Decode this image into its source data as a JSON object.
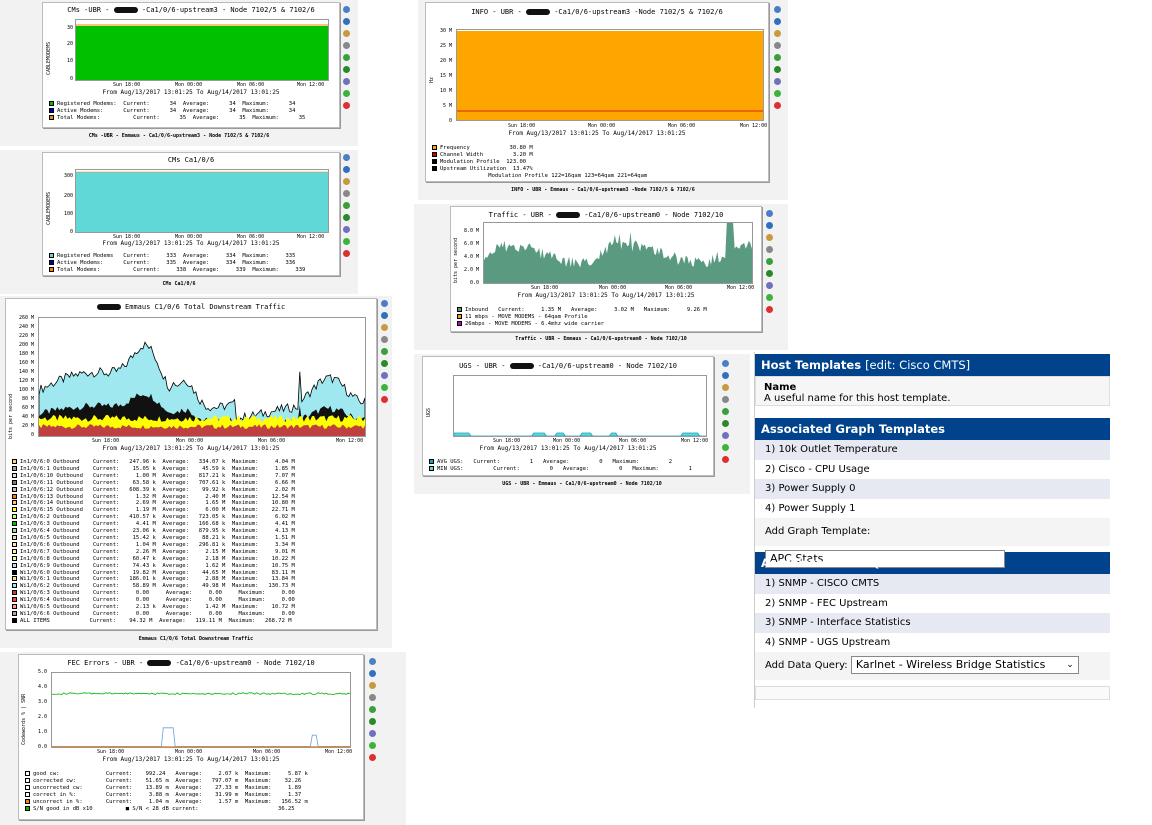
{
  "redacted": "",
  "tool_icons": [
    {
      "icon": "zoom-icon",
      "color": "#4a7fc8"
    },
    {
      "icon": "query-icon",
      "color": "#3070c0"
    },
    {
      "icon": "wrench-icon",
      "color": "#c89a40"
    },
    {
      "icon": "spike-icon",
      "color": "#888888"
    },
    {
      "icon": "csv-icon",
      "color": "#3aa03a"
    },
    {
      "icon": "bars-icon",
      "color": "#2a8a2a"
    },
    {
      "icon": "properties-icon",
      "color": "#7070c0"
    },
    {
      "icon": "add-icon",
      "color": "#3cb43c"
    },
    {
      "icon": "delete-icon",
      "color": "#dd3030"
    }
  ],
  "graphs": {
    "cms_upstream3": {
      "title_a": "CMs -UBR -",
      "title_b": "-Ca1/0/6-upstream3 - Node 7102/5 & 7102/6",
      "ylabel": "CABLEMODEMS",
      "yticks": [
        "30",
        "20",
        "10",
        "0"
      ],
      "xticks": [
        "Sun 18:00",
        "Mon 00:00",
        "Mon 06:00",
        "Mon 12:00"
      ],
      "range": "From Aug/13/2017 13:01:25 To Aug/14/2017 13:01:25",
      "legend": [
        {
          "color": "#00c000",
          "text": "Registered Modems:  Current:      34  Average:      34  Maximum:      34"
        },
        {
          "color": "#0000a0",
          "text": "Active Modems:      Current:      34  Average:      34  Maximum:      34"
        },
        {
          "color": "#ff8000",
          "text": "Total Modems:          Current:      35  Average:      35  Maximum:      35"
        }
      ],
      "caption": "CMs -UBR - Emmaus - Ca1/0/6-upstream3 - Node 7102/5 & 7102/6"
    },
    "cms_ca": {
      "title": "CMs Ca1/0/6",
      "ylabel": "CABLEMODEMS",
      "yticks": [
        "300",
        "200",
        "100",
        "0"
      ],
      "xticks": [
        "Sun 18:00",
        "Mon 00:00",
        "Mon 06:00",
        "Mon 12:00"
      ],
      "range": "From Aug/13/2017 13:01:25 To Aug/14/2017 13:01:25",
      "legend": [
        {
          "color": "#60d8d8",
          "text": "Registered Modems   Current:     333  Average:     334  Maximum:     335"
        },
        {
          "color": "#0000a0",
          "text": "Active Modems:      Current:     335  Average:     334  Maximum:     336"
        },
        {
          "color": "#ff8000",
          "text": "Total Modems:          Current:     338  Average:     339  Maximum:     339"
        }
      ],
      "caption": "CMs Ca1/0/6"
    },
    "downstream": {
      "title": "Emmaus C1/0/6 Total Downstream Traffic",
      "ylabel": "bits per second",
      "yticks": [
        "260 M",
        "240 M",
        "220 M",
        "200 M",
        "180 M",
        "160 M",
        "140 M",
        "120 M",
        "100 M",
        "80 M",
        "60 M",
        "40 M",
        "20 M",
        "0"
      ],
      "xticks": [
        "Sun 18:00",
        "Mon 00:00",
        "Mon 06:00",
        "Mon 12:00"
      ],
      "range": "From Aug/13/2017 13:01:25 To Aug/14/2017 13:01:25",
      "legend": [
        {
          "color": "#f4d880",
          "text": "In1/0/6:0 Outbound    Current:   247.96 k  Average:   334.07 k  Maximum:     4.04 M"
        },
        {
          "color": "#a0a0a0",
          "text": "In1/0/6:1 Outbound    Current:    15.05 k  Average:    45.59 k  Maximum:     1.85 M"
        },
        {
          "color": "#e0e0e0",
          "text": "In1/0/6:10 Outbound   Current:     1.00 M  Average:   817.21 k  Maximum:     7.07 M"
        },
        {
          "color": "#808080",
          "text": "In1/0/6:11 Outbound   Current:    63.58 k  Average:   707.61 k  Maximum:     6.66 M"
        },
        {
          "color": "#c0c0c0",
          "text": "In1/0/6:12 Outbound   Current:   608.39 k  Average:    99.92 k  Maximum:     2.02 M"
        },
        {
          "color": "#ff8000",
          "text": "In1/0/6:13 Outbound   Current:     1.32 M  Average:     2.40 M  Maximum:    12.54 M"
        },
        {
          "color": "#ffc080",
          "text": "In1/0/6:14 Outbound   Current:     2.69 M  Average:     1.65 M  Maximum:    10.80 M"
        },
        {
          "color": "#ffff00",
          "text": "In1/0/6:15 Outbound   Current:     1.19 M  Average:     6.00 M  Maximum:    22.71 M"
        },
        {
          "color": "#c0ff80",
          "text": "In1/0/6:2 Outbound    Current:   410.57 k  Average:   723.05 k  Maximum:     6.02 M"
        },
        {
          "color": "#00c000",
          "text": "In1/0/6:3 Outbound    Current:     4.41 M  Average:   166.68 k  Maximum:     4.41 M"
        },
        {
          "color": "#a0e0a0",
          "text": "In1/0/6:4 Outbound    Current:    23.06 k  Average:   879.95 k  Maximum:     4.13 M"
        },
        {
          "color": "#e0e0a0",
          "text": "In1/0/6:5 Outbound    Current:    15.42 k  Average:    88.21 k  Maximum:     1.51 M"
        },
        {
          "color": "#ffe0c0",
          "text": "In1/0/6:6 Outbound    Current:     1.04 M  Average:   296.81 k  Maximum:     3.34 M"
        },
        {
          "color": "#fff0a0",
          "text": "In1/0/6:7 Outbound    Current:     2.26 M  Average:     2.15 M  Maximum:     9.01 M"
        },
        {
          "color": "#e0ffa0",
          "text": "In1/0/6:8 Outbound    Current:    60.47 k  Average:     2.18 M  Maximum:    10.22 M"
        },
        {
          "color": "#c0e0ff",
          "text": "In1/0/6:9 Outbound    Current:    74.43 k  Average:     1.62 M  Maximum:    10.75 M"
        },
        {
          "color": "#000000",
          "text": "Wi1/0/6:0 Outbound    Current:    19.82 M  Average:    44.65 M  Maximum:    83.11 M"
        },
        {
          "color": "#ffe080",
          "text": "Wi1/0/6:1 Outbound    Current:   186.01 k  Average:     2.88 M  Maximum:    13.84 M"
        },
        {
          "color": "#a0e8f0",
          "text": "Wi1/0/6:2 Outbound    Current:    58.89 M  Average:    49.98 M  Maximum:   130.73 M"
        },
        {
          "color": "#c04040",
          "text": "Wi1/0/6:3 Outbound    Current:     0.00     Average:     0.00     Maximum:     0.00"
        },
        {
          "color": "#ff4040",
          "text": "Wi1/0/6:4 Outbound    Current:     0.00     Average:     0.00     Maximum:     0.00"
        },
        {
          "color": "#ffa0a0",
          "text": "Wi1/0/6:5 Outbound    Current:     2.13 k  Average:     1.42 M  Maximum:    10.72 M"
        },
        {
          "color": "#c0a0a0",
          "text": "Wi1/0/6:6 Outbound    Current:     0.00     Average:     0.00     Maximum:     0.00"
        },
        {
          "color": "#000000",
          "text": "ALL ITEMS            Current:    94.32 M  Average:   119.11 M  Maximum:   268.72 M"
        }
      ],
      "caption": "Emmaus C1/0/6 Total Downstream Traffic"
    },
    "fec": {
      "title_a": "FEC Errors  - UBR  -",
      "title_b": "-Ca1/0/6-upstream0 - Node 7102/10",
      "ylabel": "Codewords % | SNR",
      "yticks": [
        "5.0",
        "4.0",
        "3.0",
        "2.0",
        "1.0",
        "0.0"
      ],
      "xticks": [
        "Sun 18:00",
        "Mon 00:00",
        "Mon 06:00",
        "Mon 12:00"
      ],
      "range": "From Aug/13/2017 13:01:25 To Aug/14/2017 13:01:25",
      "legend": [
        {
          "color": "#ffffff",
          "text": "good cw:              Current:    992.24   Average:     2.07 k  Maximum:     5.87 k"
        },
        {
          "color": "#ffffff",
          "text": "corrected cw:         Current:    51.65 m  Average:   797.07 m  Maximum:    32.26"
        },
        {
          "color": "#ffffff",
          "text": "uncorrected cw:       Current:    13.89 m  Average:    27.33 m  Maximum:     1.89"
        },
        {
          "color": "#ffffff",
          "text": "correct in %:         Current:     3.88 m  Average:    31.99 m  Maximum:     1.37"
        },
        {
          "color": "#ff8000",
          "text": "uncorrect in %:       Current:     1.04 m  Average:     1.57 m  Maximum:   156.52 m"
        },
        {
          "color": "#00c000",
          "text": "S/N good in dB x10          ■ S/N < 28 dB current:                        36.25"
        }
      ],
      "caption": "FEC Errors - UBR - Emmaus - Ca1/0/6-upstream0 - Node 7102/10"
    },
    "info": {
      "title_a": "INFO - UBR  -",
      "title_b": "-Ca1/0/6-upstream3 -Node 7102/5 & 7102/6",
      "ylabel": "Hz",
      "yticks": [
        "30 M",
        "25 M",
        "20 M",
        "15 M",
        "10 M",
        "5 M",
        "0"
      ],
      "xticks": [
        "Sun 18:00",
        "Mon 00:00",
        "Mon 06:00",
        "Mon 12:00"
      ],
      "range": "From Aug/13/2017 13:01:25 To Aug/14/2017 13:01:25",
      "legend": [
        {
          "color": "#ffa500",
          "text": "Frequency            30.80 M"
        },
        {
          "color": "#c00000",
          "text": "Channel Width         3.20 M"
        },
        {
          "color": "#000000",
          "text": "Modulation Profile  123.00"
        },
        {
          "color": "#000000",
          "text": "Upstream Utilization  13.47%"
        },
        {
          "color": "",
          "text": "                 Modulation Profile 122=16qam 123=64qam 221=64qam"
        }
      ],
      "caption": "INFO - UBR - Emmaus - Ca1/0/6-upstream3 -Node 7102/5 & 7102/6"
    },
    "traffic": {
      "title_a": "Traffic - UBR  -",
      "title_b": "-Ca1/0/6-upstream0 - Node 7102/10",
      "ylabel": "bits per second",
      "yticks": [
        "8.0 M",
        "6.0 M",
        "4.0 M",
        "2.0 M",
        "0.0"
      ],
      "xticks": [
        "Sun 18:00",
        "Mon 00:00",
        "Mon 06:00",
        "Mon 12:00"
      ],
      "range": "From Aug/13/2017 13:01:25 To Aug/14/2017 13:01:25",
      "legend": [
        {
          "color": "#5a9a80",
          "text": "Inbound   Current:     1.35 M   Average:     3.02 M   Maximum:     9.26 M"
        },
        {
          "color": "#ffa500",
          "text": "11 mbps - MOVE MODEMS - 64qam Profile"
        },
        {
          "color": "#c000c0",
          "text": "26mbps - MOVE MODEMS - 6.4mhz wide carrier"
        }
      ],
      "caption": "Traffic - UBR - Emmaus - Ca1/0/6-upstream0 - Node 7102/10"
    },
    "ugs": {
      "title_a": "UGS - UBR  -",
      "title_b": "-Ca1/0/6-upstream0 - Node 7102/10",
      "ylabel": "UGS",
      "yticks": [],
      "xticks": [
        "Sun 18:00",
        "Mon 00:00",
        "Mon 06:00",
        "Mon 12:00"
      ],
      "range": "From Aug/13/2017 13:01:25 To Aug/14/2017 13:01:25",
      "legend": [
        {
          "color": "#1aa0c0",
          "text": "AVG UGS:   Current:         1   Average:         0   Maximum:         2"
        },
        {
          "color": "#60d8d8",
          "text": "MIN UGS:         Current:         0   Average:         0   Maximum:         1"
        }
      ],
      "caption": "UGS - UBR - Emmaus - Ca1/0/6-upstream0 - Node 7102/10"
    }
  },
  "host": {
    "section1_title": "Host Templates",
    "section1_edit": "[edit: Cisco CMTS]",
    "name_label": "Name",
    "name_desc": "A useful name for this host template.",
    "section2_title": "Associated Graph Templates",
    "graph_templates": [
      "1) 10k Outlet Temperature",
      "2) Cisco - CPU Usage",
      "3) Power Supply 0",
      "4) Power Supply 1"
    ],
    "add_graph_label": "Add Graph Template:",
    "add_graph_value": "APC Stats",
    "section3_title": "Associated Data Queries",
    "data_queries": [
      "1) SNMP - CISCO CMTS",
      "2) SNMP - FEC Upstream",
      "3) SNMP - Interface Statistics",
      "4) SNMP - UGS Upstream"
    ],
    "add_query_label": "Add Data Query:",
    "add_query_value": "Karlnet - Wireless Bridge Statistics"
  }
}
